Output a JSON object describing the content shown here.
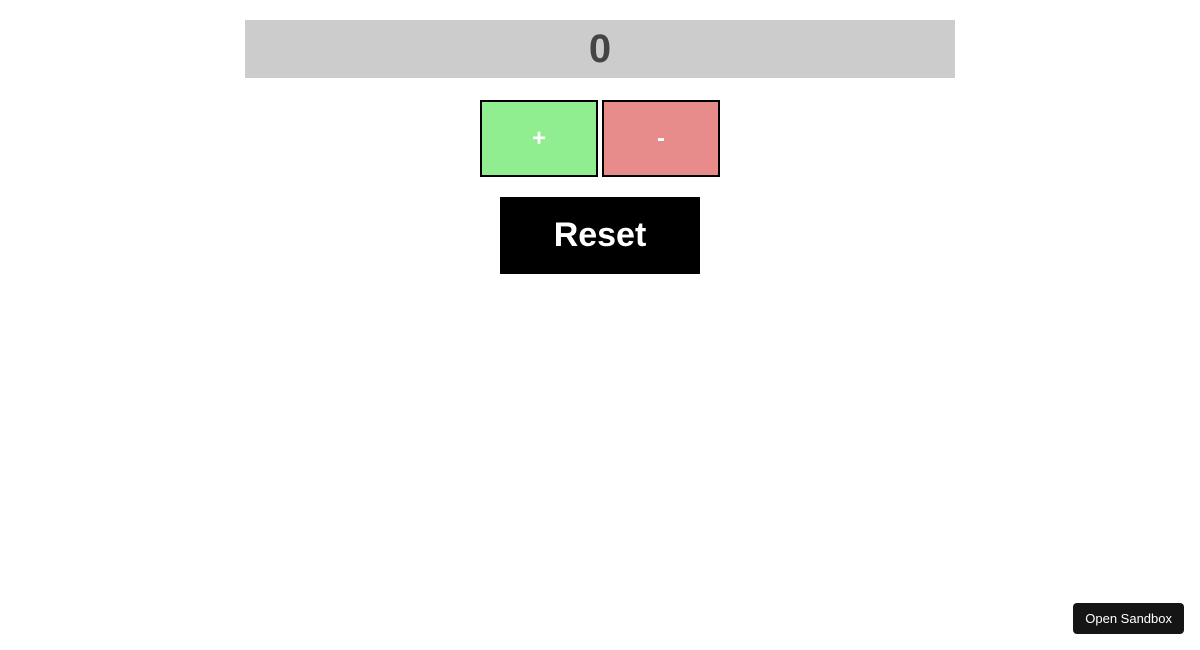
{
  "counter": {
    "value": "0"
  },
  "buttons": {
    "increment_label": "+",
    "decrement_label": "-",
    "reset_label": "Reset"
  },
  "sandbox": {
    "open_label": "Open Sandbox"
  }
}
